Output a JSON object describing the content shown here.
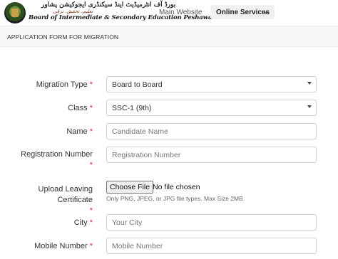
{
  "header": {
    "brand_urdu": "بورڈ آف انٹرمیڈیٹ اینڈ سیکنڈری ایجوکیشن پشاور",
    "brand_urdu_sub": "تعلیم، تحقیق، ترقی",
    "brand_en": "Board of Intermediate & Secondary Education Peshawar",
    "nav_main": "Main Website",
    "nav_online": "Online Services"
  },
  "section": {
    "title": "APPLICATION FORM FOR MIGRATION"
  },
  "form": {
    "migration_type": {
      "label": "Migration Type",
      "value": "Board to Board"
    },
    "class": {
      "label": "Class",
      "value": "SSC-1 (9th)"
    },
    "name": {
      "label": "Name",
      "placeholder": "Candidate Name"
    },
    "registration": {
      "label_line1": "Registration Number",
      "placeholder": "Registration Number"
    },
    "upload": {
      "label_line1": "Upload Leaving",
      "label_line2": "Certificate",
      "button": "Choose File",
      "status": "No file chosen",
      "help": "Only PNG, JPEG, or JPG file types. Max Size 2MB."
    },
    "city": {
      "label": "City",
      "placeholder": "Your City"
    },
    "mobile": {
      "label": "Mobile Number",
      "placeholder": "Mobile Number"
    },
    "required_mark": "*"
  }
}
